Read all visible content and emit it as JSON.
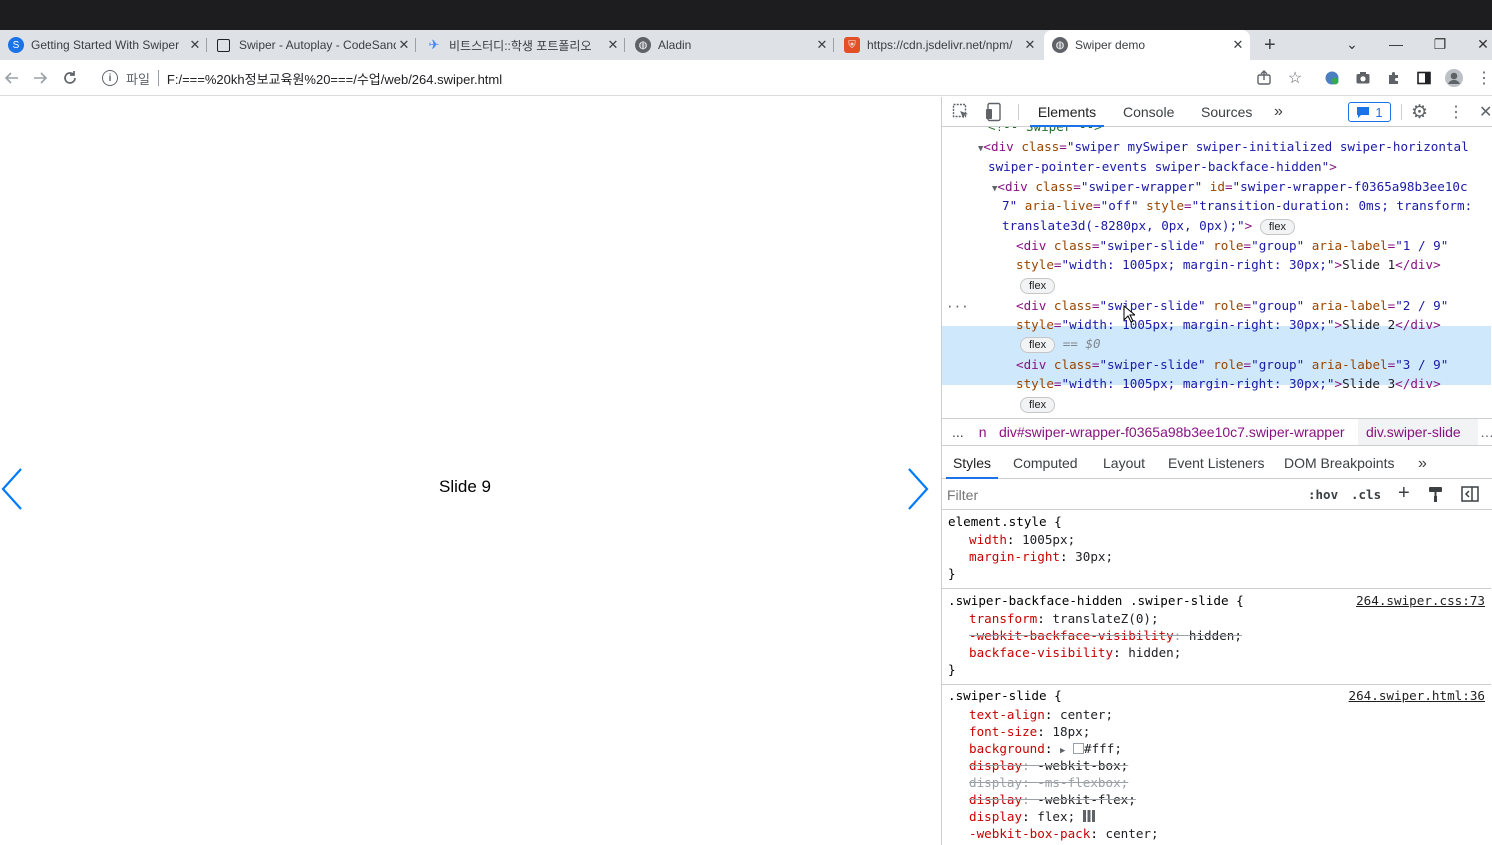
{
  "browser": {
    "tabs": [
      {
        "title": "Getting Started With Swiper",
        "icon": "swiper-favicon",
        "color": "#1a73e8"
      },
      {
        "title": "Swiper - Autoplay - CodeSandbox",
        "icon": "codesandbox-favicon",
        "color": "#202124"
      },
      {
        "title": "비트스터디::학생 포트폴리오",
        "icon": "bitstudy-favicon",
        "color": "#3b82f6"
      },
      {
        "title": "Aladin",
        "icon": "globe-icon",
        "color": "#5f6368"
      },
      {
        "title": "https://cdn.jsdelivr.net/npm/",
        "icon": "jsdelivr-favicon",
        "color": "#e34f26"
      },
      {
        "title": "Swiper demo",
        "icon": "globe-icon",
        "color": "#5f6368"
      }
    ],
    "new_tab": "+",
    "window_controls": {
      "minimize": "—",
      "restore": "❐",
      "close": "✕",
      "dropdown": "⌄"
    },
    "address": {
      "label": "파일",
      "url": "F:/===%20kh정보교육원%20===/수업/web/264.swiper.html"
    }
  },
  "page": {
    "slide_text": "Slide 9",
    "accent": "#007aff"
  },
  "devtools": {
    "tabs": [
      "Elements",
      "Console",
      "Sources"
    ],
    "more": "»",
    "issues_count": "1",
    "dom": {
      "comment": "<!-- Swiper -->",
      "swiper_div": {
        "tag": "div",
        "class_attr": "class",
        "class_val": "\"swiper mySwiper swiper-initialized swiper-horizontal",
        "class_val2": "swiper-pointer-events swiper-backface-hidden\""
      },
      "wrapper": {
        "line1_a": "<div ",
        "line1_class": "class",
        "line1_classval": "\"swiper-wrapper\"",
        "line1_id": "id",
        "line1_idval": "\"swiper-wrapper-f0365a98b3ee10c",
        "line2_idval": "7\"",
        "line2_aria": "aria-live",
        "line2_ariaval": "\"off\"",
        "line2_style": "style",
        "line2_styleval": "\"transition-duration: 0ms; transform:",
        "line3_styleval": "translate3d(-8280px, 0px, 0px);\"",
        "pill": "flex"
      },
      "slides": [
        {
          "aria": "\"1 / 9\"",
          "text": "Slide 1",
          "pill": "flex"
        },
        {
          "aria": "\"2 / 9\"",
          "text": "Slide 2",
          "pill": "flex",
          "selected_marker": "== $0"
        },
        {
          "aria": "\"3 / 9\"",
          "text": "Slide 3",
          "pill": "flex"
        }
      ],
      "slide_class": "\"swiper-slide\"",
      "slide_role": "\"group\"",
      "slide_style": "\"width: 1005px; margin-right: 30px;\""
    },
    "breadcrumb": {
      "ellipsis": "...",
      "prev": " n",
      "wrapper": "div#swiper-wrapper-f0365a98b3ee10c7.swiper-wrapper",
      "slide": "div.swiper-slide",
      "more": "…"
    },
    "styles_tabs": [
      "Styles",
      "Computed",
      "Layout",
      "Event Listeners",
      "DOM Breakpoints"
    ],
    "filter_placeholder": "Filter",
    "filter_tools": {
      "hov": ":hov",
      "cls": ".cls",
      "add": "+"
    },
    "rules": [
      {
        "selector": "element.style {",
        "source": "",
        "props": [
          {
            "name": "width",
            "value": "1005px;",
            "struck": false
          },
          {
            "name": "margin-right",
            "value": "30px;",
            "struck": false
          }
        ]
      },
      {
        "selector": ".swiper-backface-hidden .swiper-slide {",
        "source": "264.swiper.css:73",
        "props": [
          {
            "name": "transform",
            "value": "translateZ(0);",
            "struck": false
          },
          {
            "name": "-webkit-backface-visibility",
            "value": "hidden;",
            "struck": true
          },
          {
            "name": "backface-visibility",
            "value": "hidden;",
            "struck": false
          }
        ]
      },
      {
        "selector": ".swiper-slide {",
        "source": "264.swiper.html:36",
        "props": [
          {
            "name": "text-align",
            "value": "center;",
            "struck": false
          },
          {
            "name": "font-size",
            "value": "18px;",
            "struck": false
          },
          {
            "name": "background",
            "value": "#fff;",
            "struck": false
          },
          {
            "name": "display",
            "value": "-webkit-box;",
            "struck": true
          },
          {
            "name": "display",
            "value": "-ms-flexbox;",
            "struck": true
          },
          {
            "name": "display",
            "value": "-webkit-flex;",
            "struck": true
          },
          {
            "name": "display",
            "value": "flex;",
            "struck": false
          },
          {
            "name": "-webkit-box-pack",
            "value": "center;",
            "struck": false
          }
        ]
      }
    ],
    "close_brace": "}"
  }
}
